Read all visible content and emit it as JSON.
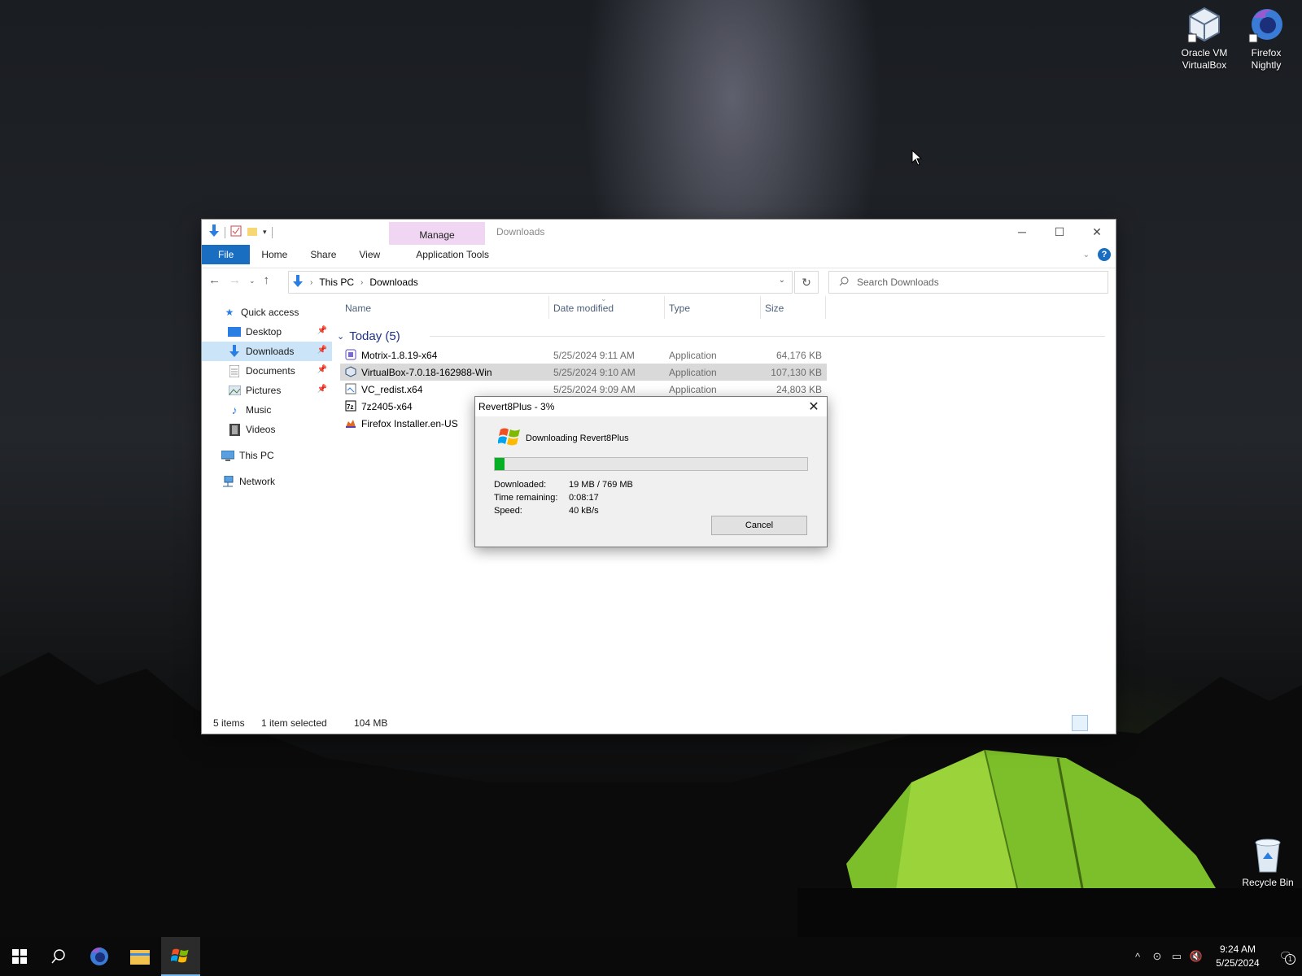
{
  "desktop": {
    "icons": [
      {
        "label_line1": "Oracle VM",
        "label_line2": "VirtualBox",
        "icon": "virtualbox-icon"
      },
      {
        "label_line1": "Firefox",
        "label_line2": "Nightly",
        "icon": "firefox-nightly-icon"
      },
      {
        "label_line1": "Recycle Bin",
        "label_line2": "",
        "icon": "recycle-bin-icon"
      }
    ]
  },
  "explorer": {
    "title": "Downloads",
    "manage_tab": "Manage",
    "ribbon_tabs": [
      "File",
      "Home",
      "Share",
      "View",
      "Application Tools"
    ],
    "breadcrumb": [
      "This PC",
      "Downloads"
    ],
    "search_placeholder": "Search Downloads",
    "nav": {
      "quick_access": "Quick access",
      "items": [
        {
          "label": "Desktop",
          "pinned": true
        },
        {
          "label": "Downloads",
          "pinned": true,
          "selected": true
        },
        {
          "label": "Documents",
          "pinned": true
        },
        {
          "label": "Pictures",
          "pinned": true
        },
        {
          "label": "Music",
          "pinned": false
        },
        {
          "label": "Videos",
          "pinned": false
        }
      ],
      "this_pc": "This PC",
      "network": "Network"
    },
    "columns": [
      "Name",
      "Date modified",
      "Type",
      "Size"
    ],
    "group_label": "Today (5)",
    "files": [
      {
        "name": "Motrix-1.8.19-x64",
        "date": "5/25/2024 9:11 AM",
        "type": "Application",
        "size": "64,176 KB"
      },
      {
        "name": "VirtualBox-7.0.18-162988-Win",
        "date": "5/25/2024 9:10 AM",
        "type": "Application",
        "size": "107,130 KB"
      },
      {
        "name": "VC_redist.x64",
        "date": "5/25/2024 9:09 AM",
        "type": "Application",
        "size": "24,803 KB"
      },
      {
        "name": "7z2405-x64",
        "date": "",
        "type": "",
        "size": ""
      },
      {
        "name": "Firefox Installer.en-US",
        "date": "",
        "type": "",
        "size": ""
      }
    ],
    "status": {
      "items": "5 items",
      "selected": "1 item selected",
      "size": "104 MB"
    }
  },
  "dialog": {
    "title": "Revert8Plus - 3%",
    "heading": "Downloading Revert8Plus",
    "progress_percent": 3,
    "downloaded_label": "Downloaded:",
    "downloaded_value": "19 MB / 769 MB",
    "time_label": "Time remaining:",
    "time_value": "0:08:17",
    "speed_label": "Speed:",
    "speed_value": "40 kB/s",
    "cancel_label": "Cancel"
  },
  "taskbar": {
    "time": "9:24 AM",
    "date": "5/25/2024",
    "notification_count": "1"
  },
  "colors": {
    "accent": "#1a6ec2",
    "progress": "#06b025",
    "manage_tab": "#f0d6f2",
    "group_header": "#1e3287"
  }
}
